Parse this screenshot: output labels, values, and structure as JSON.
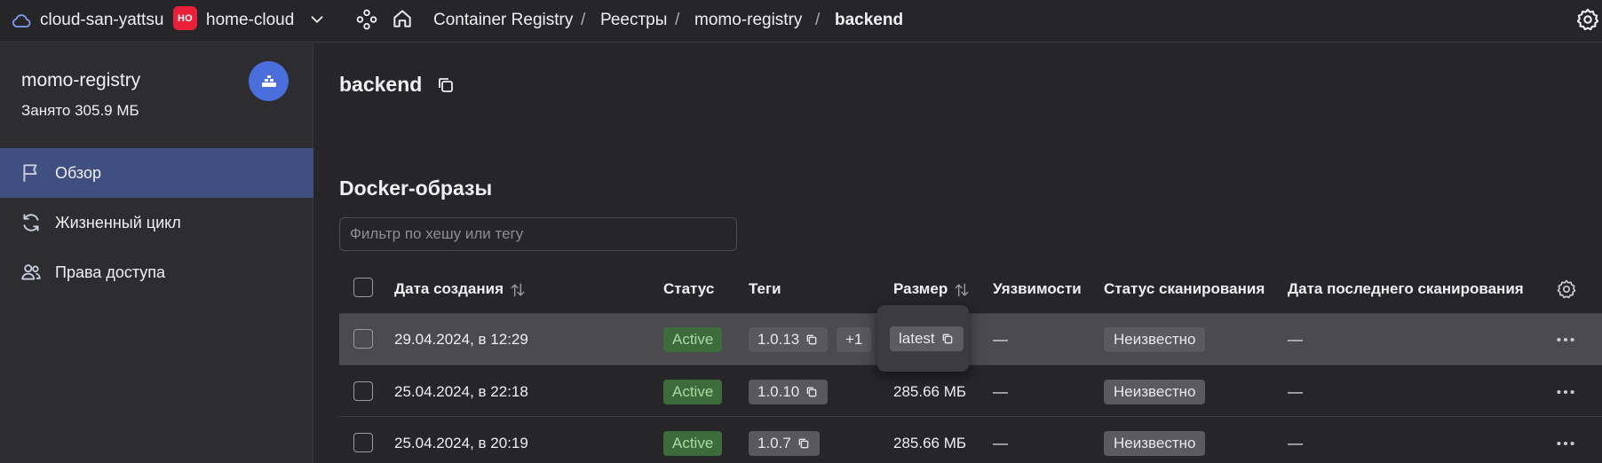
{
  "topbar": {
    "cloud_name": "cloud-san-yattsu",
    "folder_badge": "НО",
    "folder_name": "home-cloud",
    "breadcrumbs": [
      "Container Registry",
      "Реестры",
      "momo-registry",
      "backend"
    ],
    "separator": "/"
  },
  "sidebar": {
    "registry_name": "momo-registry",
    "used_space": "Занято 305.9 МБ",
    "items": [
      {
        "label": "Обзор",
        "icon": "flag-icon",
        "active": true
      },
      {
        "label": "Жизненный цикл",
        "icon": "refresh-icon",
        "active": false
      },
      {
        "label": "Права доступа",
        "icon": "users-icon",
        "active": false
      }
    ]
  },
  "main": {
    "title": "backend",
    "section_title": "Docker-образы",
    "filter_placeholder": "Фильтр по хешу или тегу"
  },
  "table": {
    "columns": [
      "Дата создания",
      "Статус",
      "Теги",
      "Размер",
      "Уязвимости",
      "Статус сканирования",
      "Дата последнего сканирования"
    ],
    "rows": [
      {
        "date": "29.04.2024, в 12:29",
        "status": "Active",
        "tag": "1.0.13",
        "extra_tags": "+1",
        "size": "",
        "vulns": "—",
        "scan_status": "Неизвестно",
        "last_scan": "—"
      },
      {
        "date": "25.04.2024, в 22:18",
        "status": "Active",
        "tag": "1.0.10",
        "extra_tags": "",
        "size": "285.66 МБ",
        "vulns": "—",
        "scan_status": "Неизвестно",
        "last_scan": "—"
      },
      {
        "date": "25.04.2024, в 20:19",
        "status": "Active",
        "tag": "1.0.7",
        "extra_tags": "",
        "size": "285.66 МБ",
        "vulns": "—",
        "scan_status": "Неизвестно",
        "last_scan": "—"
      }
    ]
  },
  "popup": {
    "tag": "latest"
  },
  "colors": {
    "accent": "#4a6fdc",
    "active_nav": "#3f4f80",
    "folder_badge": "#e8203a",
    "status_active_bg": "#3d6b3c",
    "status_active_text": "#a6dca2"
  }
}
